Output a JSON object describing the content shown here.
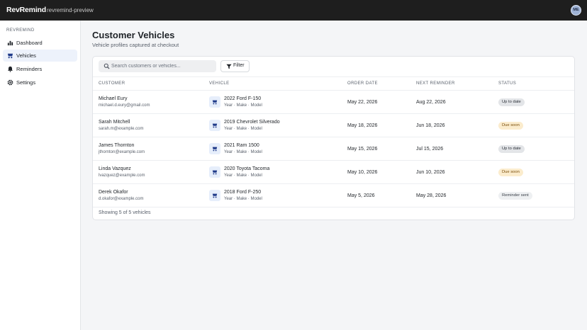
{
  "app": {
    "brand": "RevRemind",
    "env": "revremind-preview",
    "avatar_initials": "ME"
  },
  "sidebar": {
    "section": "REVREMIND",
    "items": [
      {
        "label": "Dashboard",
        "icon": "bar-chart-icon",
        "active": false
      },
      {
        "label": "Vehicles",
        "icon": "car-icon",
        "active": true
      },
      {
        "label": "Reminders",
        "icon": "bell-icon",
        "active": false
      },
      {
        "label": "Settings",
        "icon": "gear-icon",
        "active": false
      }
    ]
  },
  "page": {
    "title": "Customer Vehicles",
    "subtitle": "Vehicle profiles captured at checkout"
  },
  "toolbar": {
    "search_placeholder": "Search customers or vehicles...",
    "filter_label": "Filter"
  },
  "table": {
    "headers": {
      "customer": "CUSTOMER",
      "vehicle": "VEHICLE",
      "order_date": "ORDER DATE",
      "next_reminder": "NEXT REMINDER",
      "status": "STATUS"
    },
    "rows": [
      {
        "name": "Michael Eury",
        "email": "michael.d.eury@gmail.com",
        "vehicle": "2022 Ford F-150",
        "vehicle_meta": "Year · Make · Model",
        "order_date": "May 22, 2026",
        "next_reminder": "Aug 22, 2026",
        "status": "Up to date",
        "status_type": "ok"
      },
      {
        "name": "Sarah Mitchell",
        "email": "sarah.m@example.com",
        "vehicle": "2019 Chevrolet Silverado",
        "vehicle_meta": "Year · Make · Model",
        "order_date": "May 18, 2026",
        "next_reminder": "Jun 18, 2026",
        "status": "Due soon",
        "status_type": "soon"
      },
      {
        "name": "James Thornton",
        "email": "jthornton@example.com",
        "vehicle": "2021 Ram 1500",
        "vehicle_meta": "Year · Make · Model",
        "order_date": "May 15, 2026",
        "next_reminder": "Jul 15, 2026",
        "status": "Up to date",
        "status_type": "ok"
      },
      {
        "name": "Linda Vazquez",
        "email": "lvazquez@example.com",
        "vehicle": "2020 Toyota Tacoma",
        "vehicle_meta": "Year · Make · Model",
        "order_date": "May 10, 2026",
        "next_reminder": "Jun 10, 2026",
        "status": "Due soon",
        "status_type": "soon"
      },
      {
        "name": "Derek Okafor",
        "email": "d.okafor@example.com",
        "vehicle": "2018 Ford F-250",
        "vehicle_meta": "Year · Make · Model",
        "order_date": "May 5, 2026",
        "next_reminder": "May 28, 2026",
        "status": "Reminder sent",
        "status_type": "sent"
      }
    ],
    "footer": "Showing 5 of 5 vehicles"
  },
  "colors": {
    "topbar": "#1e1e1e",
    "accent": "#1f3a8a",
    "active_nav_bg": "#edf2fb",
    "due_soon_bg": "#fbeccd"
  }
}
